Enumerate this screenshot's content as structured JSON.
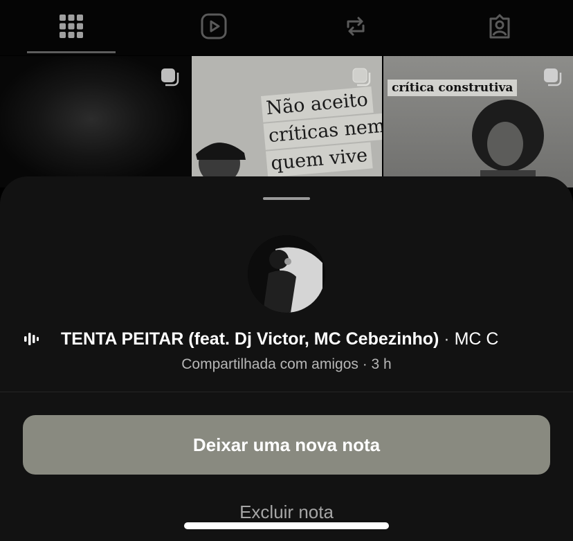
{
  "tabs": [
    {
      "name": "posts",
      "icon": "grid-icon",
      "active": true
    },
    {
      "name": "reels",
      "icon": "reels-icon",
      "active": false
    },
    {
      "name": "reposts",
      "icon": "repost-icon",
      "active": false
    },
    {
      "name": "tagged",
      "icon": "tagged-user-icon",
      "active": false
    }
  ],
  "grid": {
    "tile2_text": [
      "Não aceito",
      "críticas nem d",
      "quem vive"
    ],
    "tile3_text": "crítica construtiva",
    "multi_icon": "carousel-icon"
  },
  "note": {
    "music_icon": "sound-bars-icon",
    "song_title": "TENTA PEITAR (feat. Dj Victor, MC Cebezinho)",
    "separator": "·",
    "artist": "MC C",
    "subtitle": "Compartilhada com amigos · 3 h"
  },
  "actions": {
    "primary": "Deixar uma nova nota",
    "secondary": "Excluir nota"
  },
  "colors": {
    "sheet_bg": "#121212",
    "primary_button": "#898a80"
  }
}
